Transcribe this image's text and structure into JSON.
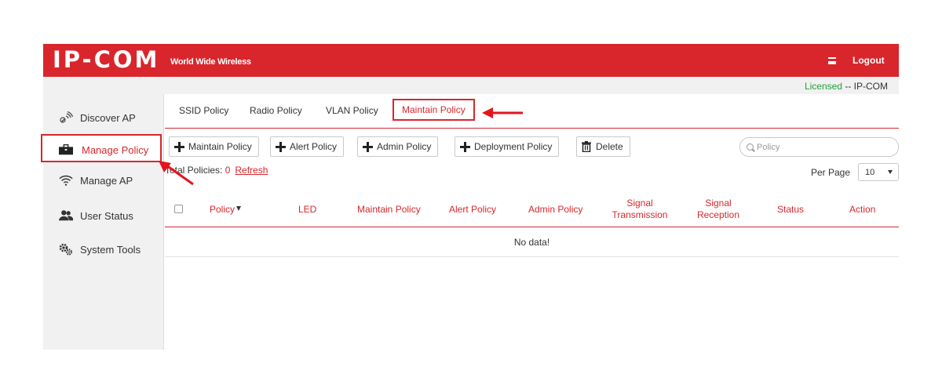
{
  "header": {
    "logo": "IP-COM",
    "slogan": "World Wide Wireless",
    "logout": "Logout"
  },
  "license": {
    "status": "Licensed",
    "separator": " -- ",
    "vendor": "IP-COM"
  },
  "sidebar": {
    "items": [
      {
        "label": "Discover AP",
        "icon": "discover-ap-icon"
      },
      {
        "label": "Manage Policy",
        "icon": "briefcase-icon"
      },
      {
        "label": "Manage AP",
        "icon": "wifi-icon"
      },
      {
        "label": "User Status",
        "icon": "users-icon"
      },
      {
        "label": "System Tools",
        "icon": "gears-icon"
      }
    ]
  },
  "tabs": [
    {
      "label": "SSID Policy"
    },
    {
      "label": "Radio Policy"
    },
    {
      "label": "VLAN Policy"
    },
    {
      "label": "Maintain Policy"
    }
  ],
  "toolbar": {
    "buttons": [
      {
        "label": "Maintain Policy"
      },
      {
        "label": "Alert Policy"
      },
      {
        "label": "Admin Policy"
      },
      {
        "label": "Deployment Policy"
      },
      {
        "label": "Delete"
      }
    ],
    "search_placeholder": "Policy"
  },
  "summary": {
    "label": "Total Policies: ",
    "count": "0",
    "refresh": "Refresh"
  },
  "pagination": {
    "per_page_label": "Per Page",
    "per_page_value": "10"
  },
  "table": {
    "columns": [
      {
        "label": "Policy"
      },
      {
        "label": "LED"
      },
      {
        "label": "Maintain Policy"
      },
      {
        "label": "Alert Policy"
      },
      {
        "label": "Admin Policy"
      },
      {
        "label": "Signal Transmission"
      },
      {
        "label": "Signal Reception"
      },
      {
        "label": "Status"
      },
      {
        "label": "Action"
      }
    ],
    "empty_text": "No data!"
  },
  "colors": {
    "brand": "#d9262c",
    "licensed": "#23a23a"
  }
}
